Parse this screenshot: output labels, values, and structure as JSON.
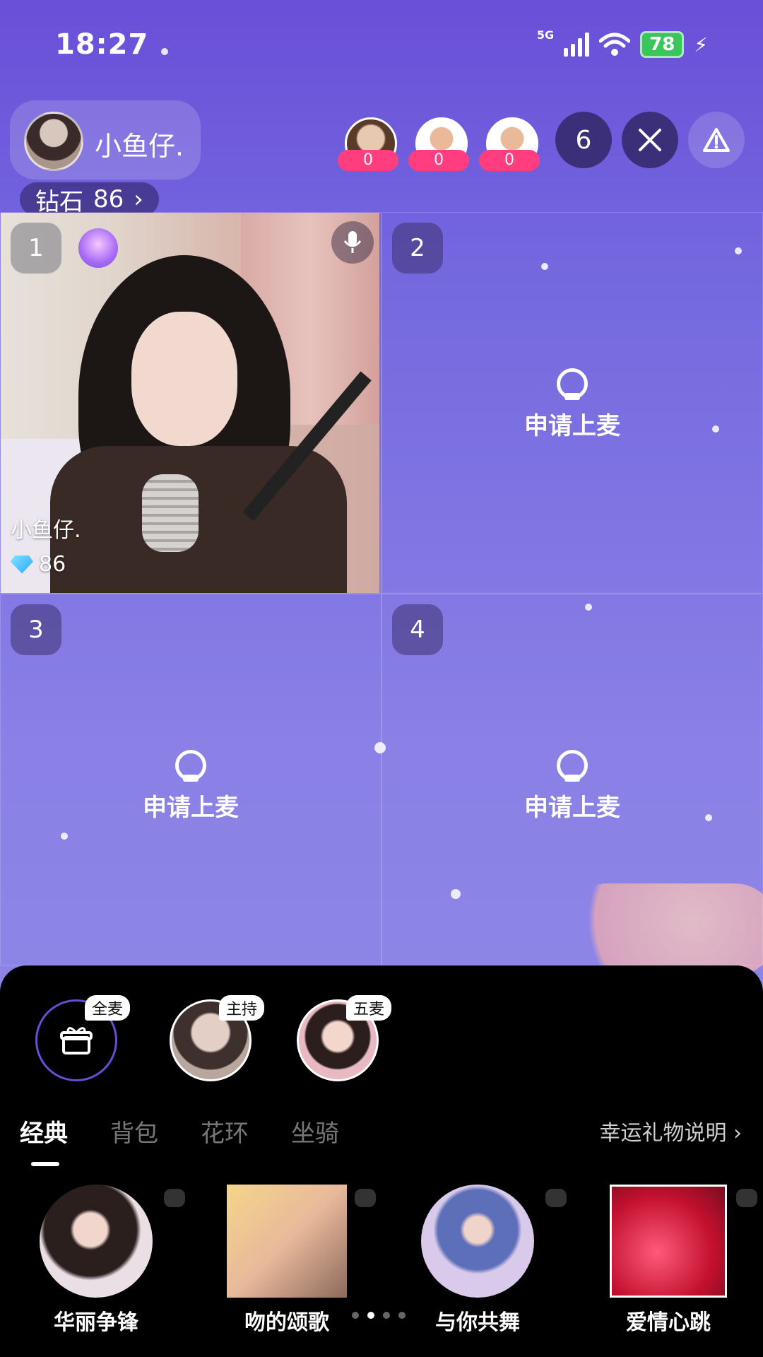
{
  "status": {
    "time": "18:27",
    "network": "5G",
    "battery": "78"
  },
  "room": {
    "host_name": "小鱼仔.",
    "diamond_label": "钻石",
    "diamond_count": "86",
    "viewer_badges": [
      "0",
      "0",
      "0"
    ],
    "online_count": "6"
  },
  "seats": [
    {
      "number": "1",
      "name": "小鱼仔.",
      "score": "86"
    },
    {
      "number": "2",
      "action": "申请上麦"
    },
    {
      "number": "3",
      "action": "申请上麦"
    },
    {
      "number": "4",
      "action": "申请上麦"
    }
  ],
  "gift_panel": {
    "recipients": [
      "全麦",
      "主持",
      "五麦"
    ],
    "tabs": [
      "经典",
      "背包",
      "花环",
      "坐骑"
    ],
    "lucky_link": "幸运礼物说明",
    "gifts": [
      "华丽争锋",
      "吻的颂歌",
      "与你共舞",
      "爱情心跳"
    ]
  }
}
